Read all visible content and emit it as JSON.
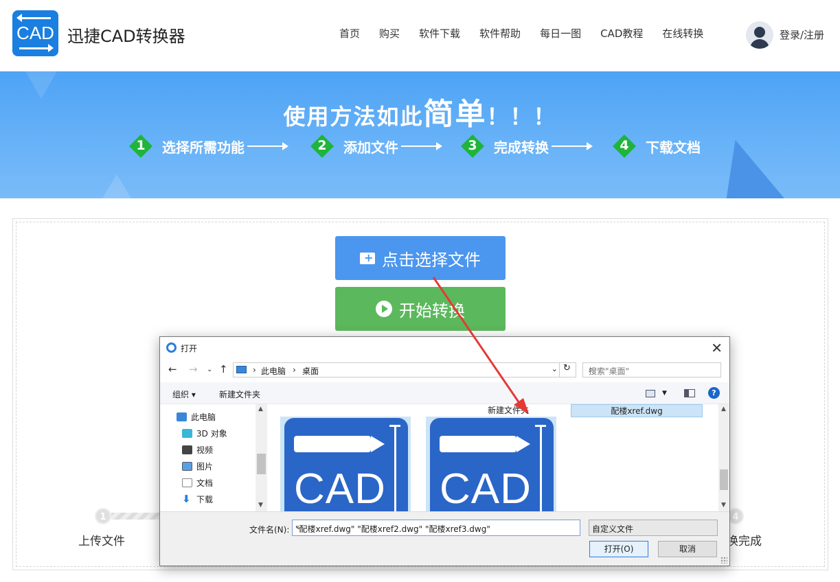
{
  "header": {
    "logo_text": "CAD",
    "site_name": "迅捷CAD转换器",
    "nav": [
      "首页",
      "购买",
      "软件下载",
      "软件帮助",
      "每日一图",
      "CAD教程",
      "在线转换"
    ],
    "login": "登录/注册"
  },
  "banner": {
    "title_prefix": "使用方法如此",
    "title_big": "简单",
    "title_suffix": "！！！",
    "steps": [
      {
        "num": "1",
        "label": "选择所需功能"
      },
      {
        "num": "2",
        "label": "添加文件"
      },
      {
        "num": "3",
        "label": "完成转换"
      },
      {
        "num": "4",
        "label": "下载文档"
      }
    ]
  },
  "upload": {
    "select_label": "点击选择文件",
    "start_label": "开始转换",
    "stage_first": "上传文件",
    "stage_last_partial": "换完成",
    "dot_first": "1",
    "dot_last": "4"
  },
  "dialog": {
    "title": "打开",
    "close": "✕",
    "address": [
      "此电脑",
      "桌面"
    ],
    "search_placeholder": "搜索\"桌面\"",
    "toolbar": {
      "organize": "组织 ▾",
      "new_folder": "新建文件夹",
      "help": "?"
    },
    "sidebar": [
      "此电脑",
      "3D 对象",
      "视频",
      "图片",
      "文档",
      "下载"
    ],
    "files": [
      {
        "caption": "新建文件夹"
      },
      {
        "caption": "配楼xref.dwg"
      }
    ],
    "icon_word": "CAD",
    "filename_label": "文件名(N):",
    "filename_value": "\"配楼xref.dwg\" \"配楼xref2.dwg\" \"配楼xref3.dwg\"",
    "filetype": "自定义文件",
    "open_btn": "打开(O)",
    "cancel_btn": "取消"
  },
  "colors": {
    "accent": "#4b96ef",
    "start_green": "#5cb85c",
    "step_green": "#1fb43a",
    "arrow_red": "#e53935"
  }
}
